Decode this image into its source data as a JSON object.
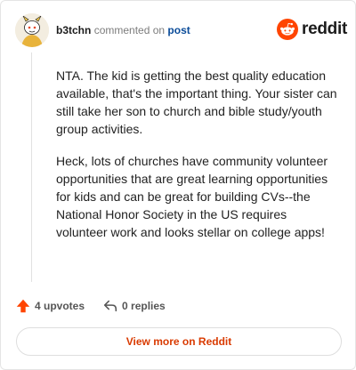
{
  "header": {
    "username": "b3tchn",
    "commented_text": "commented on",
    "post_link": "post"
  },
  "logo": {
    "text": "reddit",
    "icon": "reddit-snoo-icon",
    "color": "#ff4500"
  },
  "comment": {
    "paragraphs": [
      "NTA. The kid is getting the best quality education available, that's the important thing. Your sister can still take her son to church and bible study/youth group activities.",
      "Heck, lots of churches have community volunteer opportunities that are great learning opportunities for kids and can be great for building CVs--the National Honor Society in the US requires volunteer work and looks stellar on college apps!"
    ]
  },
  "actions": {
    "upvotes_label": "4 upvotes",
    "replies_label": "0 replies",
    "upvote_icon": "upvote-arrow-icon",
    "reply_icon": "reply-arrow-icon"
  },
  "view_more": {
    "label": "View more on Reddit",
    "color": "#d93a00"
  },
  "colors": {
    "link": "#0a4b99",
    "accent": "#ff4500",
    "upvote": "#ff4500"
  }
}
